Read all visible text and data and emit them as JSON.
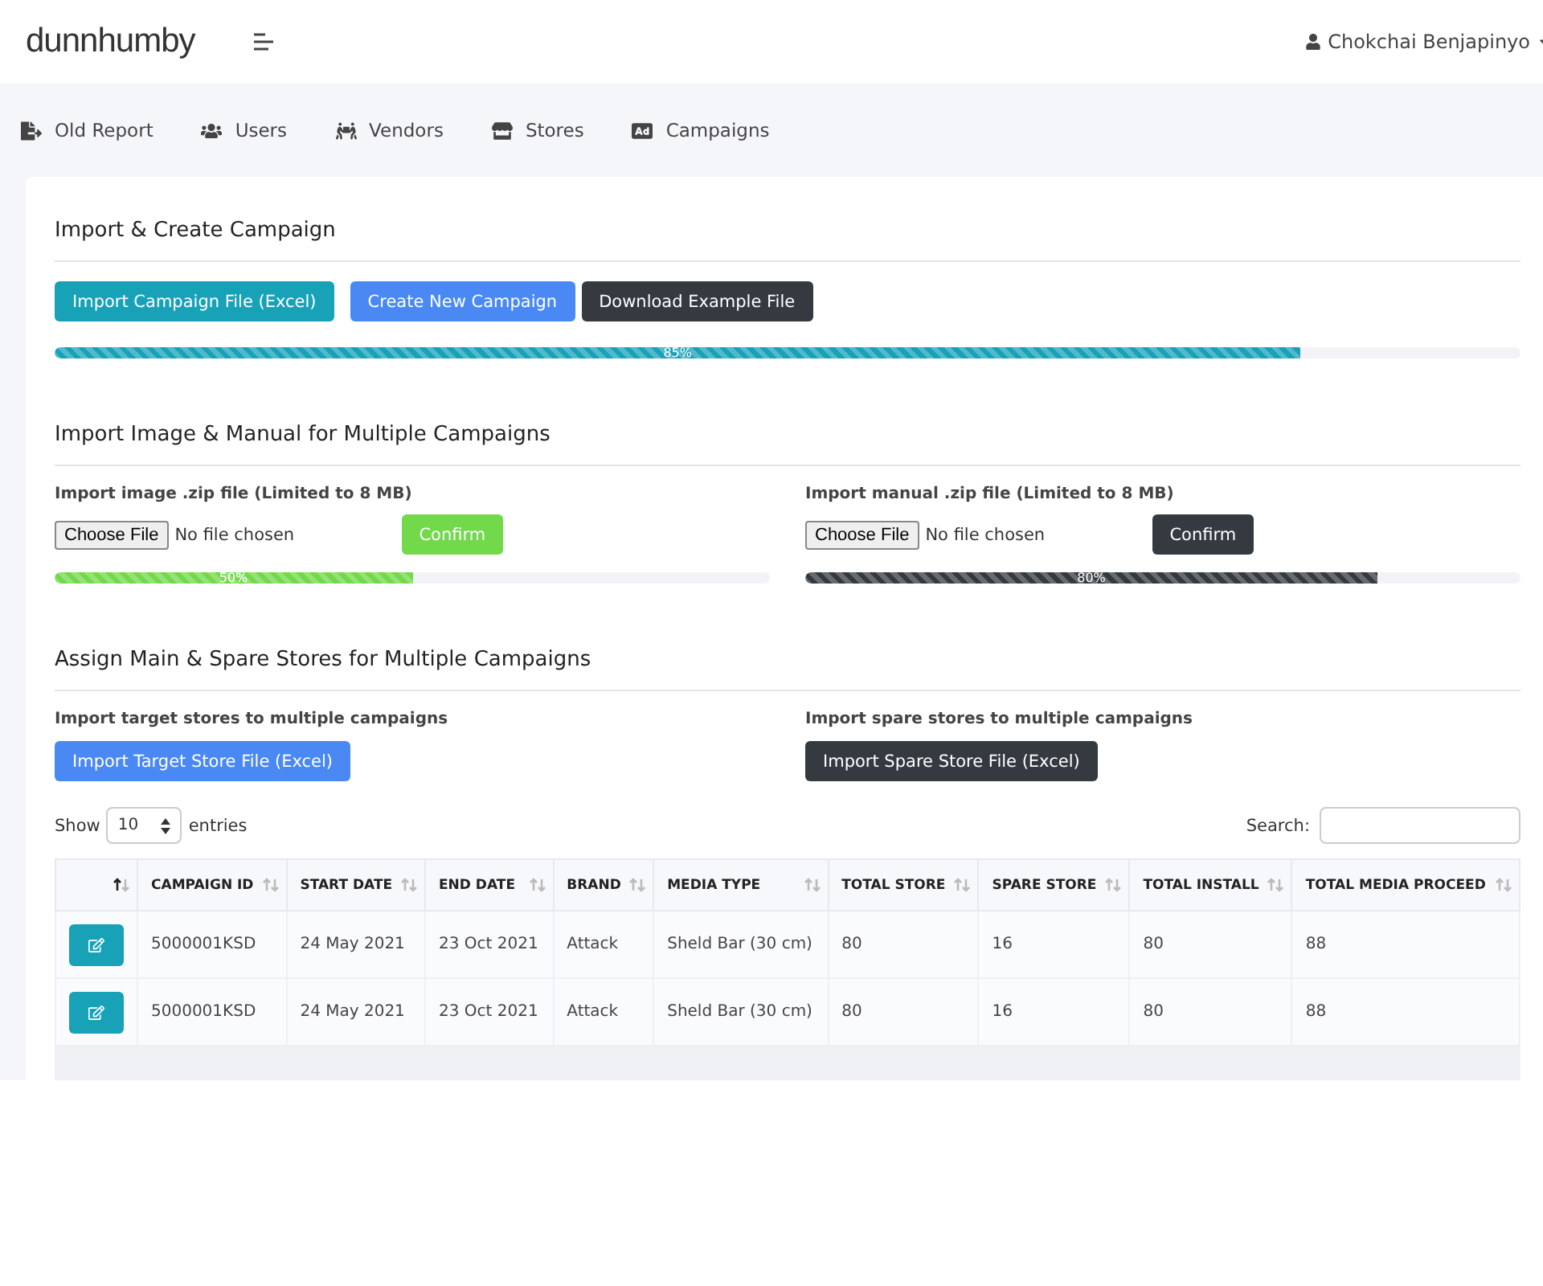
{
  "header": {
    "logo": "dunnhumby",
    "user": "Chokchai Benjapinyo"
  },
  "nav": [
    {
      "label": "Old Report"
    },
    {
      "label": "Users"
    },
    {
      "label": "Vendors"
    },
    {
      "label": "Stores"
    },
    {
      "label": "Campaigns"
    }
  ],
  "import_section": {
    "title": "Import & Create Campaign",
    "buttons": [
      {
        "label": "Import Campaign File (Excel)",
        "kind": "info"
      },
      {
        "label": "Create New Campaign",
        "kind": "primary"
      },
      {
        "label": "Download Example File",
        "kind": "dark"
      }
    ],
    "progress": {
      "level": 0.85,
      "label": "85%",
      "kind": "info"
    }
  },
  "image_section": {
    "title": "Import Image & Manual for Multiple Campaigns",
    "uploads": [
      {
        "label": "Import image .zip file (Limited to 8 MB)",
        "choose": "Choose File",
        "file": "No file chosen",
        "confirm": "Confirm",
        "kind": "success",
        "progress": {
          "level": 0.5,
          "label": "50%",
          "kind": "success"
        }
      },
      {
        "label": "Import manual .zip file (Limited to 8 MB)",
        "choose": "Choose File",
        "file": "No file chosen",
        "confirm": "Confirm",
        "kind": "dark",
        "progress": {
          "level": 0.8,
          "label": "80%",
          "kind": "dark"
        }
      }
    ]
  },
  "stores_section": {
    "title": "Assign Main & Spare Stores for Multiple Campaigns",
    "imports": [
      {
        "label": "Import target stores to multiple campaigns",
        "button": "Import Target Store File (Excel)",
        "kind": "primary"
      },
      {
        "label": "Import spare stores to multiple campaigns",
        "button": "Import Spare Store File (Excel)",
        "kind": "dark"
      }
    ]
  },
  "table": {
    "show_label": "Show",
    "page_size": "10",
    "entries_label": "entries",
    "search_label": "Search:",
    "columns": [
      {
        "sorted": true
      },
      {
        "label": "CAMPAIGN ID",
        "sorted": false
      },
      {
        "label": "START DATE",
        "sorted": false
      },
      {
        "label": "END DATE",
        "sorted": false
      },
      {
        "label": "BRAND",
        "sorted": false
      },
      {
        "label": "MEDIA TYPE",
        "sorted": false
      },
      {
        "label": "TOTAL STORE",
        "sorted": false
      },
      {
        "label": "SPARE STORE",
        "sorted": false
      },
      {
        "label": "TOTAL INSTALL",
        "sorted": false
      },
      {
        "label": "TOTAL MEDIA PROCEED",
        "sorted": false
      }
    ],
    "rows": [
      [
        "",
        "5000001KSD",
        "24 May 2021",
        "23 Oct 2021",
        "Attack",
        "Sheld Bar (30 cm)",
        "80",
        "16",
        "80",
        "88"
      ],
      [
        "",
        "5000001KSD",
        "24 May 2021",
        "23 Oct 2021",
        "Attack",
        "Sheld Bar (30 cm)",
        "80",
        "16",
        "80",
        "88"
      ]
    ]
  }
}
